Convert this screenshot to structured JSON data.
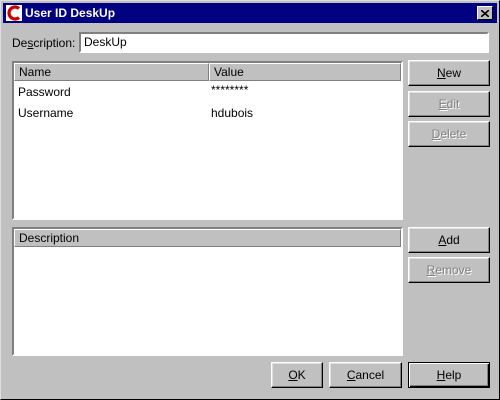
{
  "window": {
    "title": "User ID DeskUp"
  },
  "description": {
    "label_pre": "De",
    "label_mnemonic": "s",
    "label_post": "cription:",
    "value": "DeskUp"
  },
  "properties": {
    "columns": [
      "Name",
      "Value"
    ],
    "rows": [
      {
        "name": "Password",
        "value": "********"
      },
      {
        "name": "Username",
        "value": "hdubois"
      }
    ]
  },
  "descriptions_panel": {
    "column": "Description"
  },
  "buttons": {
    "new": {
      "mnemonic": "N",
      "rest": "ew",
      "enabled": true
    },
    "edit": {
      "mnemonic": "E",
      "rest": "dit",
      "enabled": false
    },
    "delete": {
      "mnemonic": "D",
      "rest": "elete",
      "enabled": false
    },
    "add": {
      "mnemonic": "A",
      "rest": "dd",
      "enabled": true
    },
    "remove": {
      "mnemonic": "R",
      "rest": "emove",
      "enabled": false
    },
    "ok": {
      "mnemonic": "O",
      "rest": "K",
      "enabled": true
    },
    "cancel": {
      "mnemonic": "C",
      "rest": "ancel",
      "enabled": true
    },
    "help": {
      "mnemonic": "H",
      "rest": "elp",
      "enabled": true
    }
  },
  "icons": {
    "app": "app-c-icon",
    "close": "close-x-icon"
  },
  "colors": {
    "titlebar": "#000080",
    "face": "#c0c0c0",
    "app_icon_red": "#cc0000",
    "disabled_text": "#808080"
  }
}
